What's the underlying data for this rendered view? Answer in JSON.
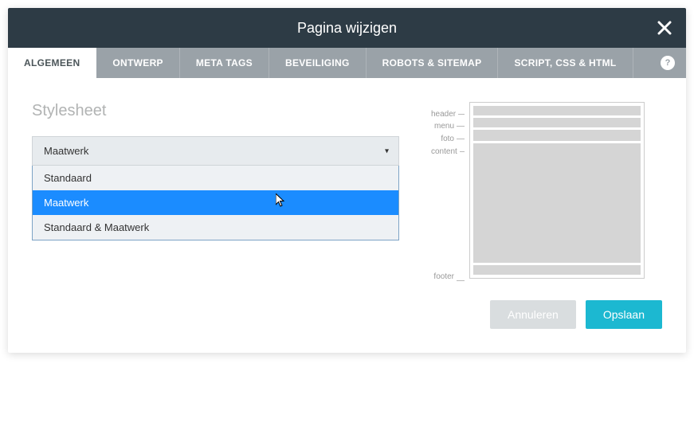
{
  "modal": {
    "title": "Pagina wijzigen"
  },
  "tabs": {
    "items": [
      {
        "label": "ALGEMEEN"
      },
      {
        "label": "ONTWERP"
      },
      {
        "label": "META TAGS"
      },
      {
        "label": "BEVEILIGING"
      },
      {
        "label": "ROBOTS & SITEMAP"
      },
      {
        "label": "SCRIPT, CSS & HTML"
      }
    ],
    "help": "?"
  },
  "section": {
    "title": "Stylesheet"
  },
  "select": {
    "value": "Maatwerk",
    "options": [
      {
        "label": "Standaard"
      },
      {
        "label": "Maatwerk"
      },
      {
        "label": "Standaard & Maatwerk"
      }
    ]
  },
  "preview": {
    "labels": {
      "header": "header",
      "menu": "menu",
      "foto": "foto",
      "content": "content",
      "footer": "footer"
    }
  },
  "footer": {
    "cancel": "Annuleren",
    "save": "Opslaan"
  }
}
